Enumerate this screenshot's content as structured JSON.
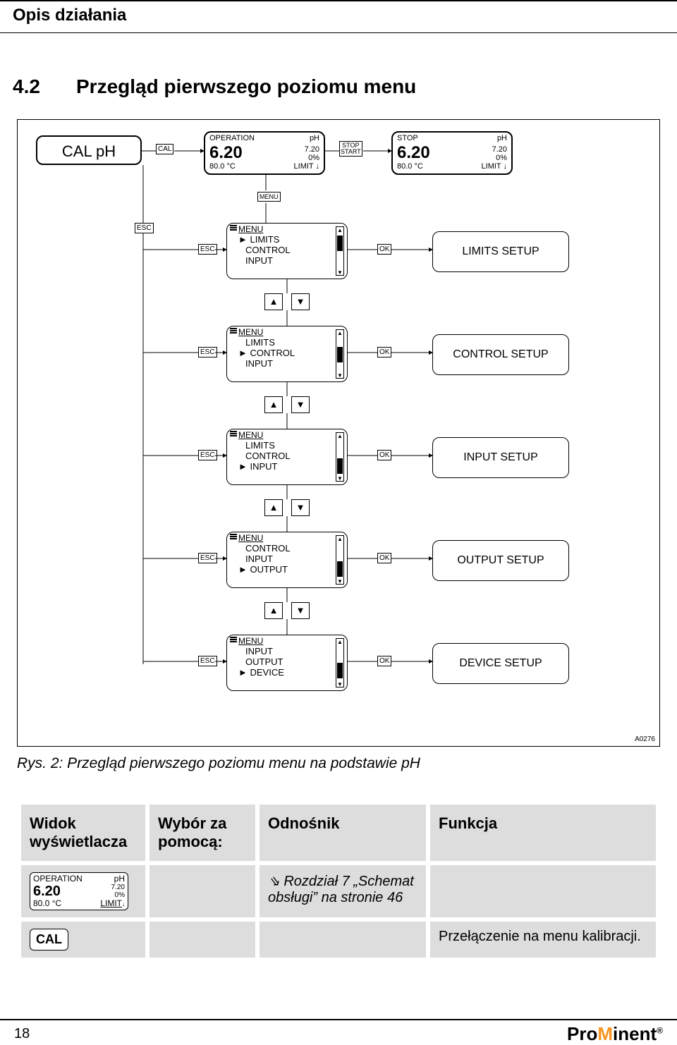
{
  "header": {
    "title": "Opis działania"
  },
  "section": {
    "number": "4.2",
    "title": "Przegląd pierwszego poziomu menu"
  },
  "diagram": {
    "cal_ph": "CAL pH",
    "cal_tag": "CAL",
    "stop_start": {
      "top": "STOP",
      "bottom": "START"
    },
    "menu_tag": "MENU",
    "esc_tag": "ESC",
    "ok_tag": "OK",
    "id_tag": "A0276",
    "lcd_operation": {
      "tl": "OPERATION",
      "tr": "pH",
      "big": "6.20",
      "mr": "7.20",
      "br2": "0%",
      "bl": "80.0 °C",
      "br": "LIMIT",
      "arrow": "↓"
    },
    "lcd_stop": {
      "tl": "STOP",
      "tr": "pH",
      "big": "6.20",
      "mr": "7.20",
      "br2": "0%",
      "bl": "80.0 °C",
      "br": "LIMIT",
      "arrow": "↓"
    },
    "menu_items": {
      "m1": {
        "head": "MENU",
        "i1": "LIMITS",
        "i2": "CONTROL",
        "i3": "INPUT",
        "sel": 1,
        "result": "LIMITS SETUP"
      },
      "m2": {
        "head": "MENU",
        "i1": "LIMITS",
        "i2": "CONTROL",
        "i3": "INPUT",
        "sel": 2,
        "result": "CONTROL SETUP"
      },
      "m3": {
        "head": "MENU",
        "i1": "LIMITS",
        "i2": "CONTROL",
        "i3": "INPUT",
        "sel": 3,
        "result": "INPUT SETUP"
      },
      "m4": {
        "head": "MENU",
        "i1": "CONTROL",
        "i2": "INPUT",
        "i3": "OUTPUT",
        "sel": 3,
        "result": "OUTPUT SETUP"
      },
      "m5": {
        "head": "MENU",
        "i1": "INPUT",
        "i2": "OUTPUT",
        "i3": "DEVICE",
        "sel": 3,
        "result": "DEVICE SETUP"
      }
    }
  },
  "caption": "Rys. 2: Przegląd pierwszego poziomu menu na podstawie pH",
  "table": {
    "head": {
      "c1": "Widok wyświet­lacza",
      "c2": "Wybór za pomocą:",
      "c3": "Odnośnik",
      "c4": "Funkcja"
    },
    "row1": {
      "c3": "Rozdział 7 „Schemat obsługi” na stronie 46"
    },
    "row2": {
      "c4": "Przełączenie na menu kalibracji."
    },
    "cal_label": "CAL"
  },
  "footer": {
    "page": "18",
    "brand_pre": "Pro",
    "brand_mid": "M",
    "brand_post": "inent",
    "reg": "®"
  }
}
